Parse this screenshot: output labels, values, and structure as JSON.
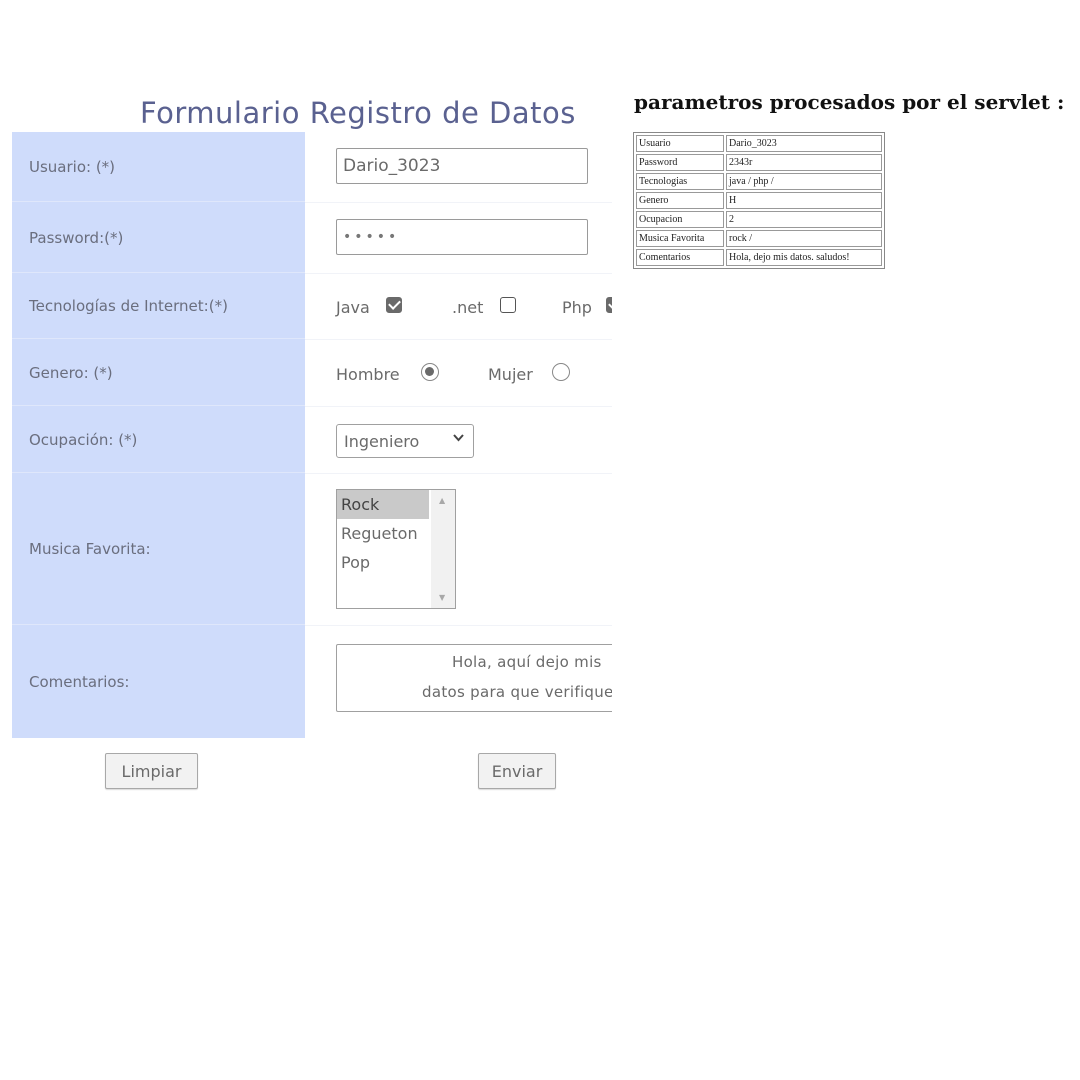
{
  "form": {
    "title": "Formulario Registro de Datos",
    "labels": {
      "usuario": "Usuario: (*)",
      "password": "Password:(*)",
      "tecnologias": "Tecnologías de Internet:(*)",
      "genero": "Genero: (*)",
      "ocupacion": "Ocupación: (*)",
      "musica": "Musica Favorita:",
      "comentarios": "Comentarios:"
    },
    "usuario_value": "Dario_3023",
    "password_mask": "•••••",
    "tecnologias": [
      {
        "label": "Java",
        "checked": true
      },
      {
        "label": ".net",
        "checked": false
      },
      {
        "label": "Php",
        "checked": true
      }
    ],
    "genero": [
      {
        "label": "Hombre",
        "checked": true
      },
      {
        "label": "Mujer",
        "checked": false
      }
    ],
    "ocupacion_selected": "Ingeniero",
    "musica_options": [
      {
        "label": "Rock",
        "selected": true
      },
      {
        "label": "Regueton",
        "selected": false
      },
      {
        "label": "Pop",
        "selected": false
      }
    ],
    "comentarios_lines": [
      "Hola, aquí dejo mis",
      "datos para que verifiques"
    ],
    "buttons": {
      "limpiar": "Limpiar",
      "enviar": "Enviar"
    }
  },
  "servlet": {
    "title": "parametros procesados por el servlet :",
    "rows": [
      {
        "key": "Usuario",
        "value": "Dario_3023"
      },
      {
        "key": "Password",
        "value": "2343r"
      },
      {
        "key": "Tecnologias",
        "value": "java / php /"
      },
      {
        "key": "Genero",
        "value": "H"
      },
      {
        "key": "Ocupacion",
        "value": "2"
      },
      {
        "key": "Musica Favorita",
        "value": "rock /"
      },
      {
        "key": "Comentarios",
        "value": "Hola, dejo mis datos. saludos!"
      }
    ]
  },
  "colors": {
    "label_bg": "#cfdcfb",
    "title_color": "#5a6190"
  }
}
